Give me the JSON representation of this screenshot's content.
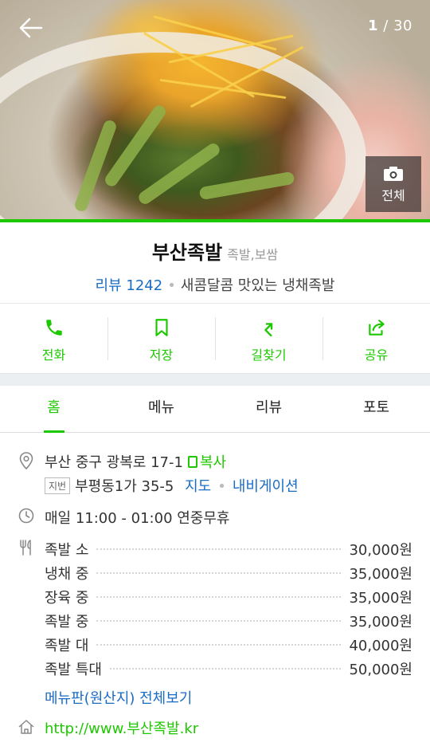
{
  "header": {
    "back_icon": "back-arrow-icon",
    "photo_counter_current": "1",
    "photo_counter_total": "/ 30",
    "all_photos_label": "전체"
  },
  "place": {
    "name": "부산족발",
    "category": "족발,보쌈",
    "review_label": "리뷰 1242",
    "tagline": "새콤달콤 맛있는 냉채족발"
  },
  "actions": [
    {
      "label": "전화",
      "icon": "phone-icon"
    },
    {
      "label": "저장",
      "icon": "bookmark-icon"
    },
    {
      "label": "길찾기",
      "icon": "directions-icon"
    },
    {
      "label": "공유",
      "icon": "share-icon"
    }
  ],
  "tabs": [
    {
      "label": "홈"
    },
    {
      "label": "메뉴"
    },
    {
      "label": "리뷰"
    },
    {
      "label": "포토"
    }
  ],
  "active_tab": "홈",
  "info": {
    "address": "부산 중구 광복로 17-1",
    "copy_label": "복사",
    "lot_tag": "지번",
    "lot_address": "부평동1가 35-5",
    "map_link": "지도",
    "navigation_link": "내비게이션",
    "hours": "매일 11:00 - 01:00 연중무휴",
    "menu": [
      {
        "name": "족발 소",
        "price": "30,000원"
      },
      {
        "name": "냉채 중",
        "price": "35,000원"
      },
      {
        "name": "장육 중",
        "price": "35,000원"
      },
      {
        "name": "족발 중",
        "price": "35,000원"
      },
      {
        "name": "족발 대",
        "price": "40,000원"
      },
      {
        "name": "족발 특대",
        "price": "50,000원"
      }
    ],
    "menu_more_link": "메뉴판(원산지) 전체보기",
    "homepage": "http://www.부산족발.kr"
  },
  "colors": {
    "accent_green": "#1ec800",
    "link_blue": "#1a6cc4"
  }
}
